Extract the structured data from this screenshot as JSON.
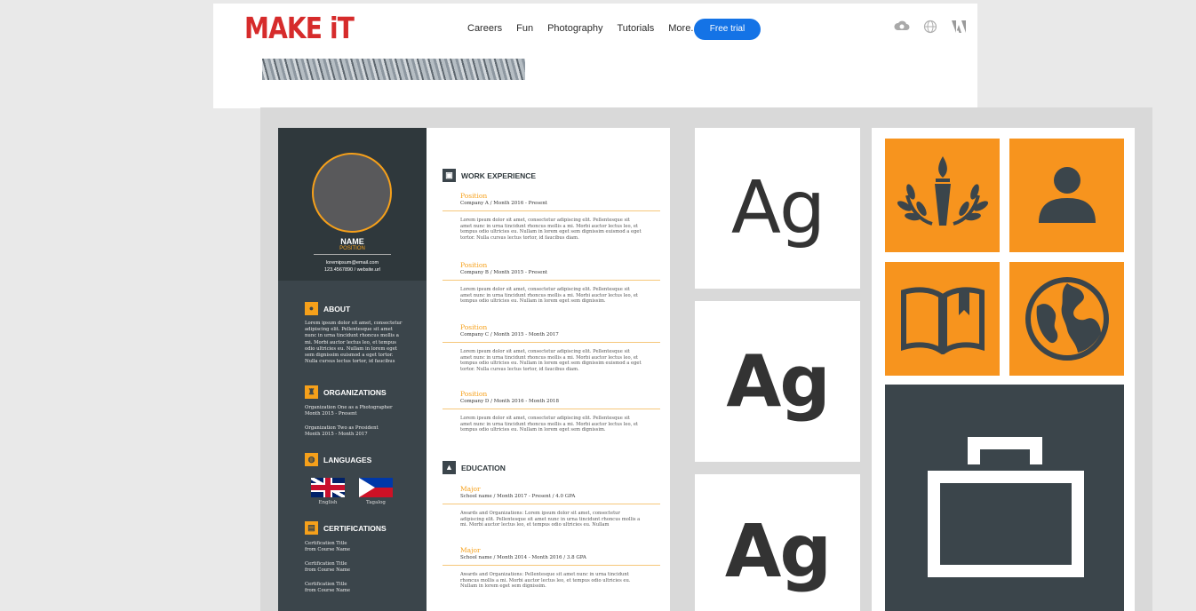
{
  "header": {
    "logo": "MAKE iT",
    "nav": [
      "Careers",
      "Fun",
      "Photography",
      "Tutorials",
      "More.."
    ],
    "free_trial": "Free trial",
    "icons": [
      "creative-cloud-icon",
      "globe-icon",
      "adobe-icon"
    ]
  },
  "resume": {
    "name": "NAME",
    "position": "POSITION",
    "contact_email": "loremipsum@email.com",
    "contact_phone_web": "123.4567890 / website.url",
    "about": {
      "heading": "ABOUT",
      "text": "Lorem ipsum dolor sit amet, consectetur adipiscing elit. Pellentesque sit amet nunc in urna tincidunt rhoncus mollis a mi. Morbi auctor lectus leo, et tempus odio ultricies eu. Nullam in lorem eget sem dignissim euismod a eget tortor. Nulla cursus lectus tortor, id faucibus"
    },
    "organizations": {
      "heading": "ORGANIZATIONS",
      "items": [
        {
          "line1": "Organization One as a Photographer",
          "line2": "Month 2015 - Present"
        },
        {
          "line1": "Organization Two as President",
          "line2": "Month 2015 - Month 2017"
        }
      ]
    },
    "languages": {
      "heading": "LANGUAGES",
      "items": [
        "English",
        "Tagalog"
      ]
    },
    "certifications": {
      "heading": "CERTIFICATIONS",
      "items": [
        {
          "line1": "Certification Title",
          "line2": "from Course Name"
        },
        {
          "line1": "Certification Title",
          "line2": "from Course Name"
        },
        {
          "line1": "Certification Title",
          "line2": "from Course Name"
        }
      ]
    },
    "work": {
      "heading": "WORK EXPERIENCE",
      "entries": [
        {
          "title": "Position",
          "sub": "Company A / Month 2016 - Present",
          "body": "Lorem ipsum dolor sit amet, consectetur adipiscing elit. Pellentesque sit amet nunc in urna tincidunt rhoncus mollis a mi. Morbi auctor lectus leo, et tempus odio ultricies eu. Nullam in lorem eget sem dignissim euismod a eget tortor. Nulla cursus lectus tortor, id faucibus diam."
        },
        {
          "title": "Position",
          "sub": "Company B / Month 2015 - Present",
          "body": "Lorem ipsum dolor sit amet, consectetur adipiscing elit. Pellentesque sit amet nunc in urna tincidunt rhoncus mollis a mi. Morbi auctor lectus leo, et tempus odio ultricies eu. Nullam in lorem eget sem dignissim."
        },
        {
          "title": "Position",
          "sub": "Company C / Month 2015 - Month 2017",
          "body": "Lorem ipsum dolor sit amet, consectetur adipiscing elit. Pellentesque sit amet nunc in urna tincidunt rhoncus mollis a mi. Morbi auctor lectus leo, et tempus odio ultricies eu. Nullam in lorem eget sem dignissim euismod a eget tortor. Nulla cursus lectus tortor, id faucibus diam."
        },
        {
          "title": "Position",
          "sub": "Company D / Month 2016 - Month 2018",
          "body": "Lorem ipsum dolor sit amet, consectetur adipiscing elit. Pellentesque sit amet nunc in urna tincidunt rhoncus mollis a mi. Morbi auctor lectus leo, et tempus odio ultricies eu. Nullam in lorem eget sem dignissim."
        }
      ]
    },
    "education": {
      "heading": "EDUCATION",
      "entries": [
        {
          "title": "Major",
          "sub": "School name / Month 2017 - Present / 4.0 GPA",
          "body": "Awards and Organizations: Lorem ipsum dolor sit amet, consectetur adipiscing elit. Pellentesque sit amet nunc in urna tincidunt rhoncus mollis a mi. Morbi auctor lectus leo, et tempus odio ultricies eu. Nullam"
        },
        {
          "title": "Major",
          "sub": "School name / Month 2014 - Month 2016 / 3.8 GPA",
          "body": "Awards and Organizations: Pellentesque sit amet nunc in urna tincidunt rhoncus mollis a mi. Morbi auctor lectus leo, et tempus odio ultricies eu. Nullam in lorem eget sem dignissim."
        }
      ]
    }
  },
  "type_samples": [
    "Ag",
    "Ag",
    "Ag"
  ],
  "icon_tiles": [
    "torch-laurel-icon",
    "person-icon",
    "book-icon",
    "globe-icon",
    "briefcase-icon"
  ],
  "colors": {
    "accent": "#f7941e",
    "dark": "#3b454b",
    "brand_red": "#d62b2b",
    "button_blue": "#1473e6"
  }
}
